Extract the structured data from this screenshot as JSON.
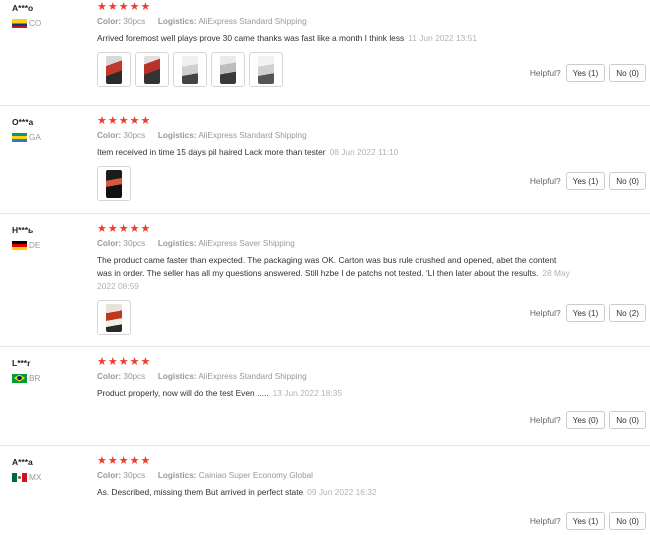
{
  "labels": {
    "color_key": "Color:",
    "logistics_key": "Logistics:",
    "helpful": "Helpful?",
    "star_glyph": "★"
  },
  "accent_color": "#f03c2e",
  "reviews": [
    {
      "user": "A***o",
      "country": "CO",
      "flag": "colombia-flag",
      "rating": 5,
      "color": "30pcs",
      "logistics": "AliExpress Standard Shipping",
      "text": "Arrived foremost well plays prove 30 came thanks was fast like a month I think less",
      "date": "11 Jun 2022 13:51",
      "photos": [
        "product-photo",
        "product-photo",
        "product-photo",
        "product-photo",
        "product-photo"
      ],
      "yes": "Yes (1)",
      "no": "No (0)"
    },
    {
      "user": "O***a",
      "country": "GA",
      "flag": "gabon-flag",
      "rating": 5,
      "color": "30pcs",
      "logistics": "AliExpress Standard Shipping",
      "text": "Item received in time 15 days pil haired Lack more than tester",
      "date": "08 Jun 2022 11:10",
      "photos": [
        "product-photo"
      ],
      "yes": "Yes (1)",
      "no": "No (0)"
    },
    {
      "user": "H***ь",
      "country": "DE",
      "flag": "germany-flag",
      "rating": 5,
      "color": "30pcs",
      "logistics": "AliExpress Saver Shipping",
      "text": "The product came faster than expected. The packaging was OK. Carton was bus rule crushed and opened, abet the content was in order. The seller has all my questions answered. Still hzbe I de patchs not tested. 'LI then later about the results.",
      "date": "28 May 2022 08:59",
      "photos": [
        "product-photo"
      ],
      "yes": "Yes (1)",
      "no": "No (2)"
    },
    {
      "user": "L***r",
      "country": "BR",
      "flag": "brazil-flag",
      "rating": 5,
      "color": "30pcs",
      "logistics": "AliExpress Standard Shipping",
      "text": "Product properly, now will do the test Even .....",
      "date": "13 Jun 2022 18:35",
      "photos": [],
      "yes": "Yes (0)",
      "no": "No (0)"
    },
    {
      "user": "A***a",
      "country": "MX",
      "flag": "mexico-flag",
      "rating": 5,
      "color": "30pcs",
      "logistics": "Cainiao Super Economy Global",
      "text": "As. Described, missing them But arrived in perfect state",
      "date": "09 Jun 2022 16:32",
      "photos": [],
      "yes": "Yes (1)",
      "no": "No (0)"
    }
  ]
}
